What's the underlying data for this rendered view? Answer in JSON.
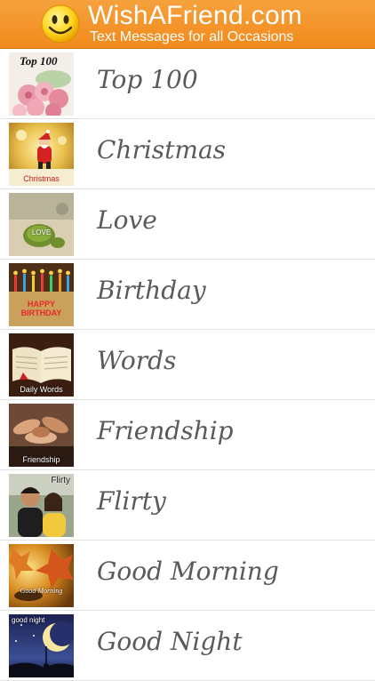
{
  "header": {
    "title": "WishAFriend.com",
    "subtitle": "Text Messages for all Occasions",
    "bg_color": "#f28a1c",
    "logo_icon": "smiley-face-icon"
  },
  "categories": [
    {
      "label": "Top 100",
      "thumb_caption": "Top 100",
      "thumb_icon": "pink-roses-icon"
    },
    {
      "label": "Christmas",
      "thumb_caption": "Christmas",
      "thumb_icon": "santa-claus-icon"
    },
    {
      "label": "Love",
      "thumb_caption": "LOVE",
      "thumb_icon": "love-leaf-icon"
    },
    {
      "label": "Birthday",
      "thumb_caption": "HAPPY BIRTHDAY",
      "thumb_icon": "birthday-cake-icon"
    },
    {
      "label": "Words",
      "thumb_caption": "Daily Words",
      "thumb_icon": "open-book-icon"
    },
    {
      "label": "Friendship",
      "thumb_caption": "Friendship",
      "thumb_icon": "joined-hands-icon"
    },
    {
      "label": "Flirty",
      "thumb_caption": "Flirty",
      "thumb_icon": "couple-icon"
    },
    {
      "label": "Good Morning",
      "thumb_caption": "Good Morning",
      "thumb_icon": "autumn-leaves-icon"
    },
    {
      "label": "Good Night",
      "thumb_caption": "good night",
      "thumb_icon": "moon-night-icon"
    }
  ]
}
